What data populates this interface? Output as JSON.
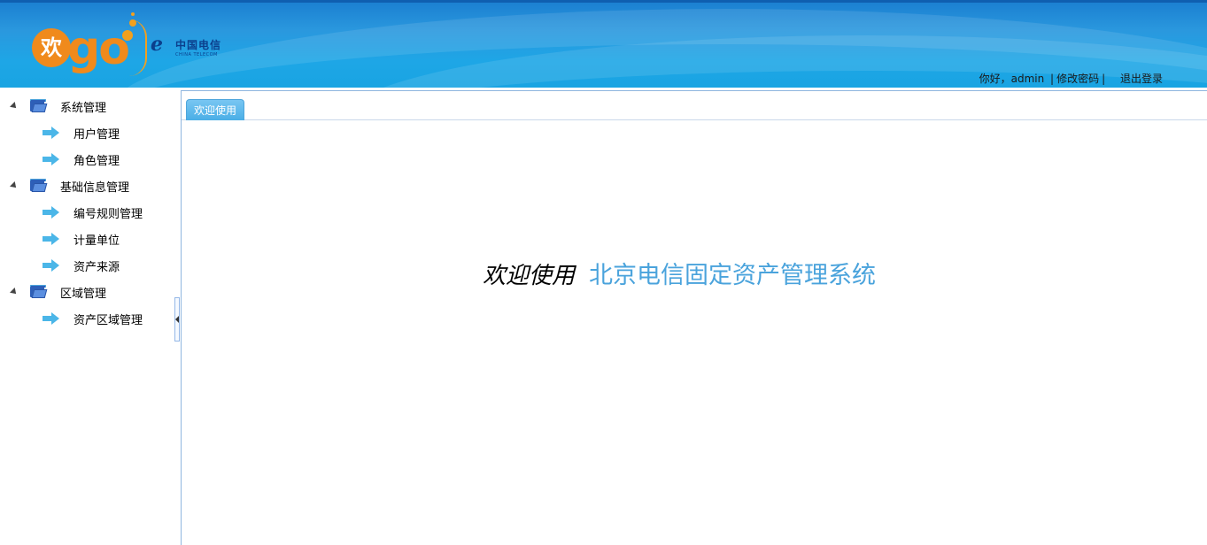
{
  "header": {
    "logo_char": "欢",
    "logo_text": "go",
    "brand_cn": "中国电信",
    "brand_en": "CHINA TELECOM",
    "greeting": "你好，admin",
    "change_password": "修改密码",
    "logout": "退出登录",
    "separator": "|"
  },
  "sidebar": {
    "nodes": [
      {
        "label": "系统管理",
        "type": "folder"
      },
      {
        "label": "用户管理",
        "type": "leaf"
      },
      {
        "label": "角色管理",
        "type": "leaf"
      },
      {
        "label": "基础信息管理",
        "type": "folder"
      },
      {
        "label": "编号规则管理",
        "type": "leaf"
      },
      {
        "label": "计量单位",
        "type": "leaf"
      },
      {
        "label": "资产来源",
        "type": "leaf"
      },
      {
        "label": "区域管理",
        "type": "folder"
      },
      {
        "label": "资产区域管理",
        "type": "leaf"
      }
    ]
  },
  "main": {
    "tabs": [
      {
        "label": "欢迎使用",
        "active": true
      }
    ],
    "welcome_prefix": "欢迎使用",
    "welcome_system": "北京电信固定资产管理系统"
  },
  "colors": {
    "header_blue": "#1ea6e6",
    "brand_orange": "#f08a1c",
    "tab_blue": "#4aaee6",
    "welcome_accent": "#4aa3dc"
  }
}
